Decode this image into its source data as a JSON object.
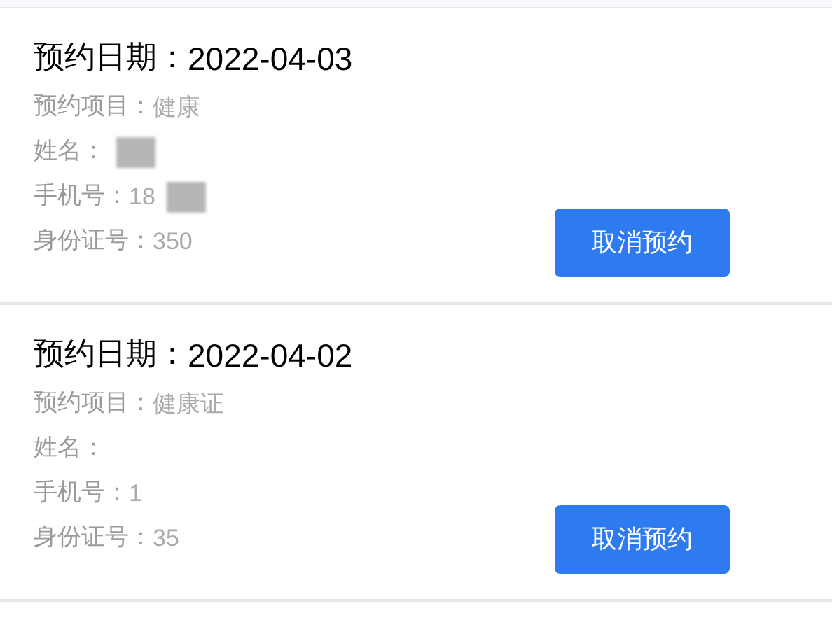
{
  "appointments": [
    {
      "date_label": "预约日期：",
      "date": "2022-04-03",
      "fields": [
        {
          "label": "预约项目：",
          "value": "健康",
          "redacted": false
        },
        {
          "label": "姓名：",
          "redacted": true
        },
        {
          "label": "手机号：",
          "value": "18",
          "redacted": true
        },
        {
          "label": "身份证号：",
          "value": "350",
          "redacted": false
        }
      ],
      "button": "取消预约"
    },
    {
      "date_label": "预约日期：",
      "date": "2022-04-02",
      "fields": [
        {
          "label": "预约项目：",
          "value": "健康证",
          "redacted": false
        },
        {
          "label": "姓名：",
          "redacted": false
        },
        {
          "label": "手机号：",
          "value": "1",
          "redacted": false
        },
        {
          "label": "身份证号：",
          "value": "35",
          "redacted": false
        }
      ],
      "button": "取消预约"
    }
  ]
}
